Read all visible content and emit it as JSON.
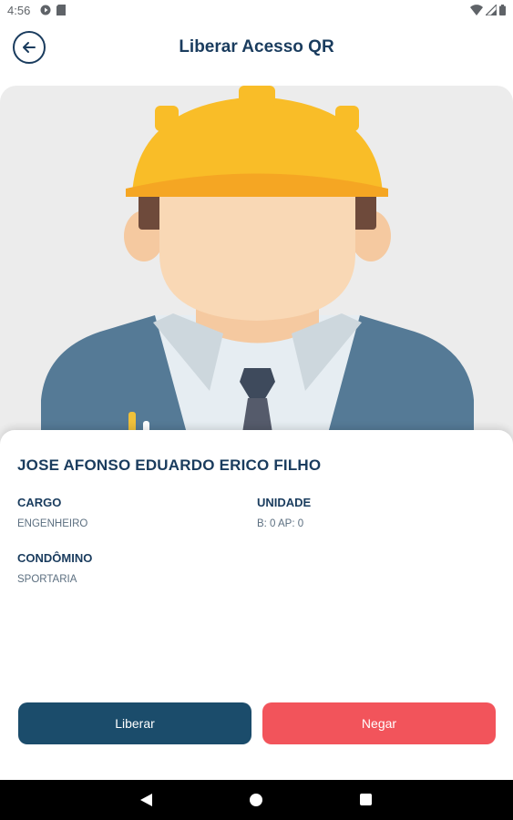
{
  "status_bar": {
    "time": "4:56",
    "left_icons": [
      "play-protect-icon",
      "sd-card-icon"
    ],
    "right_icons": [
      "wifi-icon",
      "cell-signal-icon",
      "battery-icon"
    ]
  },
  "header": {
    "title": "Liberar Acesso QR",
    "back_icon": "arrow-left-icon"
  },
  "photo": {
    "subject": "worker-avatar-illustration"
  },
  "person": {
    "name": "JOSE AFONSO EDUARDO ERICO FILHO",
    "cargo_label": "CARGO",
    "cargo_value": "ENGENHEIRO",
    "unidade_label": "UNIDADE",
    "unidade_value": "B: 0 AP: 0",
    "condominio_label": "CONDÔMINO",
    "condominio_value": "SPORTARIA"
  },
  "actions": {
    "approve_label": "Liberar",
    "deny_label": "Negar"
  },
  "colors": {
    "primary": "#1a3c5e",
    "approve": "#1b4c6b",
    "deny": "#f2545b"
  }
}
